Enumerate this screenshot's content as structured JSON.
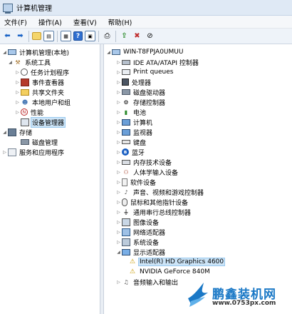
{
  "window": {
    "title": "计算机管理"
  },
  "menubar": {
    "items": [
      "文件(F)",
      "操作(A)",
      "查看(V)",
      "帮助(H)"
    ]
  },
  "toolbar": {
    "buttons": [
      {
        "name": "back-button",
        "icon": "back-arrow-icon",
        "glyph": "⬅"
      },
      {
        "name": "forward-button",
        "icon": "forward-arrow-icon",
        "glyph": "➡"
      },
      {
        "name": "up-folder-button",
        "icon": "folder-up-icon",
        "glyph": ""
      },
      {
        "name": "show-tree-button",
        "icon": "console-tree-icon",
        "glyph": "▤"
      },
      {
        "name": "properties-button",
        "icon": "properties-icon",
        "glyph": "▦"
      },
      {
        "name": "help-button",
        "icon": "help-icon",
        "glyph": "?"
      },
      {
        "name": "action-pane-button",
        "icon": "action-pane-icon",
        "glyph": "▣"
      },
      {
        "name": "scan-hardware-button",
        "icon": "scan-hardware-icon",
        "glyph": "⎙"
      },
      {
        "name": "update-driver-button",
        "icon": "update-driver-icon",
        "glyph": "⇪"
      },
      {
        "name": "uninstall-button",
        "icon": "uninstall-icon",
        "glyph": "✖"
      },
      {
        "name": "disable-button",
        "icon": "disable-icon",
        "glyph": "⊘"
      }
    ]
  },
  "left_tree": [
    {
      "label": "计算机管理(本地)",
      "icon": "computer-management-icon",
      "depth": 0,
      "arrow": "◢"
    },
    {
      "label": "系统工具",
      "icon": "system-tools-icon",
      "depth": 1,
      "arrow": "◢"
    },
    {
      "label": "任务计划程序",
      "icon": "task-scheduler-icon",
      "depth": 2,
      "arrow": "▷"
    },
    {
      "label": "事件查看器",
      "icon": "event-viewer-icon",
      "depth": 2,
      "arrow": "▷"
    },
    {
      "label": "共享文件夹",
      "icon": "shared-folders-icon",
      "depth": 2,
      "arrow": "▷"
    },
    {
      "label": "本地用户和组",
      "icon": "local-users-icon",
      "depth": 2,
      "arrow": "▷"
    },
    {
      "label": "性能",
      "icon": "performance-icon",
      "depth": 2,
      "arrow": "▷"
    },
    {
      "label": "设备管理器",
      "icon": "device-manager-icon",
      "depth": 2,
      "arrow": "",
      "selected": true
    },
    {
      "label": "存储",
      "icon": "storage-icon",
      "depth": 1,
      "arrow": "◢"
    },
    {
      "label": "磁盘管理",
      "icon": "disk-management-icon",
      "depth": 2,
      "arrow": ""
    },
    {
      "label": "服务和应用程序",
      "icon": "services-apps-icon",
      "depth": 1,
      "arrow": "▷"
    }
  ],
  "device_tree": {
    "root": "WIN-T8FPJA0UMUU",
    "categories": [
      {
        "label": "IDE ATA/ATAPI 控制器",
        "icon": "ide-controller-icon"
      },
      {
        "label": "Print queues",
        "icon": "print-queue-icon"
      },
      {
        "label": "处理器",
        "icon": "processor-icon"
      },
      {
        "label": "磁盘驱动器",
        "icon": "disk-drive-icon"
      },
      {
        "label": "存储控制器",
        "icon": "storage-controller-icon"
      },
      {
        "label": "电池",
        "icon": "battery-icon"
      },
      {
        "label": "计算机",
        "icon": "computer-icon"
      },
      {
        "label": "监视器",
        "icon": "monitor-icon"
      },
      {
        "label": "键盘",
        "icon": "keyboard-icon"
      },
      {
        "label": "蓝牙",
        "icon": "bluetooth-icon"
      },
      {
        "label": "内存技术设备",
        "icon": "memory-tech-icon"
      },
      {
        "label": "人体学输入设备",
        "icon": "hid-icon"
      },
      {
        "label": "软件设备",
        "icon": "software-device-icon"
      },
      {
        "label": "声音、视频和游戏控制器",
        "icon": "sound-icon"
      },
      {
        "label": "鼠标和其他指针设备",
        "icon": "mouse-icon"
      },
      {
        "label": "通用串行总线控制器",
        "icon": "usb-icon"
      },
      {
        "label": "图像设备",
        "icon": "imaging-device-icon"
      },
      {
        "label": "网络适配器",
        "icon": "network-adapter-icon"
      },
      {
        "label": "系统设备",
        "icon": "system-device-icon"
      },
      {
        "label": "显示适配器",
        "icon": "display-adapter-icon",
        "expanded": true,
        "children": [
          {
            "label": "Intel(R) HD Graphics 4600",
            "icon": "warning-display-icon",
            "selected": true
          },
          {
            "label": "NVIDIA GeForce 840M",
            "icon": "warning-display-icon"
          }
        ]
      },
      {
        "label": "音频输入和输出",
        "icon": "audio-io-icon"
      }
    ]
  },
  "watermark": {
    "title": "鹏鑫装机网",
    "url": "www.0753px.com"
  }
}
